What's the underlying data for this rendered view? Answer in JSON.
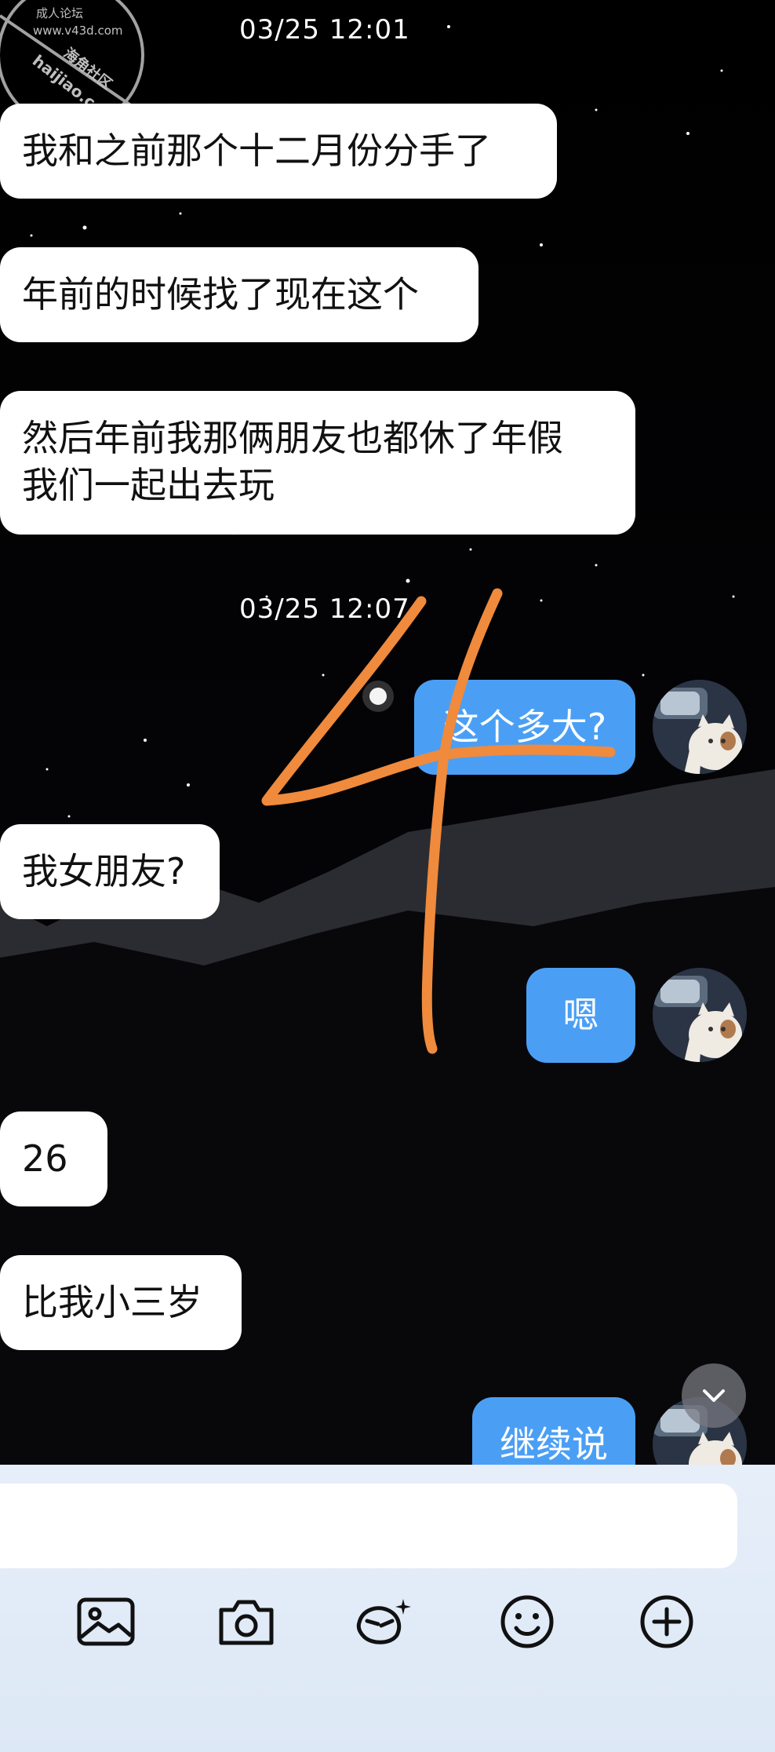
{
  "watermark": {
    "line1": "成人论坛",
    "line2": "www.v43d.com",
    "line3": "海角社区",
    "line4": "haijiao.com"
  },
  "timestamps": [
    "03/25 12:01",
    "03/25 12:07"
  ],
  "messages": [
    {
      "side": "incoming",
      "text": "我和之前那个十二月份分手了"
    },
    {
      "side": "incoming",
      "text": "年前的时候找了现在这个"
    },
    {
      "side": "incoming",
      "line1": "然后年前我那俩朋友也都休了年假",
      "line2": "我们一起出去玩"
    },
    {
      "side": "outgoing",
      "text": "这个多大?"
    },
    {
      "side": "incoming",
      "text": "我女朋友?"
    },
    {
      "side": "outgoing",
      "text": "嗯"
    },
    {
      "side": "incoming",
      "text": "26"
    },
    {
      "side": "incoming",
      "text": "比我小三岁"
    },
    {
      "side": "outgoing",
      "text": "继续说"
    }
  ],
  "annotation": {
    "text": "4",
    "color": "#f08a3c"
  },
  "colors": {
    "outgoing_bubble": "#4a9ff5",
    "incoming_bubble": "#ffffff",
    "panel_bg": "#e2ebf7"
  },
  "input": {
    "value": "",
    "placeholder": ""
  },
  "toolbar": [
    {
      "icon": "image-icon"
    },
    {
      "icon": "camera-icon"
    },
    {
      "icon": "sticker-icon"
    },
    {
      "icon": "emoji-icon"
    },
    {
      "icon": "plus-icon"
    }
  ]
}
